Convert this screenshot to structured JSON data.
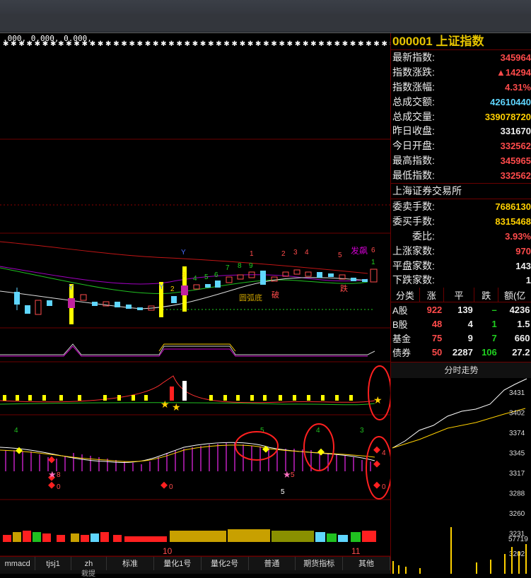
{
  "indicator_values": ".000, 0.000, 0.000,",
  "panel": {
    "code": "000001",
    "name": "上证指数",
    "rows": [
      {
        "label": "最新指数:",
        "value": "345964",
        "color": "#ff4b4b"
      },
      {
        "label": "指数涨跌:",
        "value": "▲14294",
        "color": "#ff4b4b"
      },
      {
        "label": "指数涨幅:",
        "value": "4.31%",
        "color": "#ff4b4b"
      },
      {
        "label": "总成交额:",
        "value": "42610440",
        "color": "#5fd6ff"
      },
      {
        "label": "总成交量:",
        "value": "339078720",
        "color": "#ffd000"
      },
      {
        "label": "昨日收盘:",
        "value": "331670",
        "color": "#eeeeee"
      },
      {
        "label": "今日开盘:",
        "value": "332562",
        "color": "#ff4b4b"
      },
      {
        "label": "最高指数:",
        "value": "345965",
        "color": "#ff4b4b"
      },
      {
        "label": "最低指数:",
        "value": "332562",
        "color": "#ff4b4b"
      }
    ],
    "exchange": "上海证券交易所",
    "rows2": [
      {
        "label": "委卖手数:",
        "value": "7686130",
        "color": "#ffd000"
      },
      {
        "label": "委买手数:",
        "value": "8315468",
        "color": "#ffd000"
      },
      {
        "label": "委比:",
        "value": "3.93%",
        "color": "#ff4b4b",
        "indent": true
      },
      {
        "label": "上涨家数:",
        "value": "970",
        "color": "#ff4b4b"
      },
      {
        "label": "平盘家数:",
        "value": "143",
        "color": "#eeeeee"
      },
      {
        "label": "下跌家数:",
        "value": "1",
        "color": "#eeeeee"
      }
    ],
    "table": {
      "headers": [
        "分类",
        "涨",
        "平",
        "跌",
        "额(亿"
      ],
      "rows": [
        {
          "name": "A股",
          "up": "922",
          "flat": "139",
          "down": "–",
          "amt": "4236"
        },
        {
          "name": "B股",
          "up": "48",
          "flat": "4",
          "down": "1",
          "amt": "1.5"
        },
        {
          "name": "基金",
          "up": "75",
          "flat": "9",
          "down": "7",
          "amt": "660"
        },
        {
          "name": "债券",
          "up": "50",
          "flat": "2287",
          "down": "106",
          "amt": "27.2"
        }
      ]
    }
  },
  "mini": {
    "title": "分时走势",
    "prices": [
      "3431",
      "3402",
      "3374",
      "3345",
      "3317",
      "3288",
      "3260",
      "3231",
      "3202"
    ],
    "vol_label": "57719"
  },
  "tabs": [
    "mmacd",
    "tjsj1",
    "zh",
    "标准",
    "量化1号",
    "量化2号",
    "普通",
    "期货指标",
    "其他"
  ],
  "bottom_text": "栽提",
  "chart": {
    "labels_t": {
      "cursor": "10",
      "cursor2": "11"
    },
    "signals": [
      "Y",
      "Y",
      "Y"
    ],
    "counts_top": [
      "1",
      "2",
      "3",
      "4",
      "5",
      "6"
    ],
    "counts_small": [
      "2",
      "3",
      "4",
      "5",
      "6",
      "7",
      "8",
      "9"
    ],
    "annot_bottom": "圆弧底",
    "annot_top": "发飙",
    "annot_break": "破",
    "annot_sell": "跌",
    "stars": [
      "8",
      "0",
      "0",
      "5",
      "4",
      "0"
    ],
    "small_labels": [
      "4",
      "5",
      "4",
      "3"
    ],
    "one": "1",
    "five": "5"
  }
}
